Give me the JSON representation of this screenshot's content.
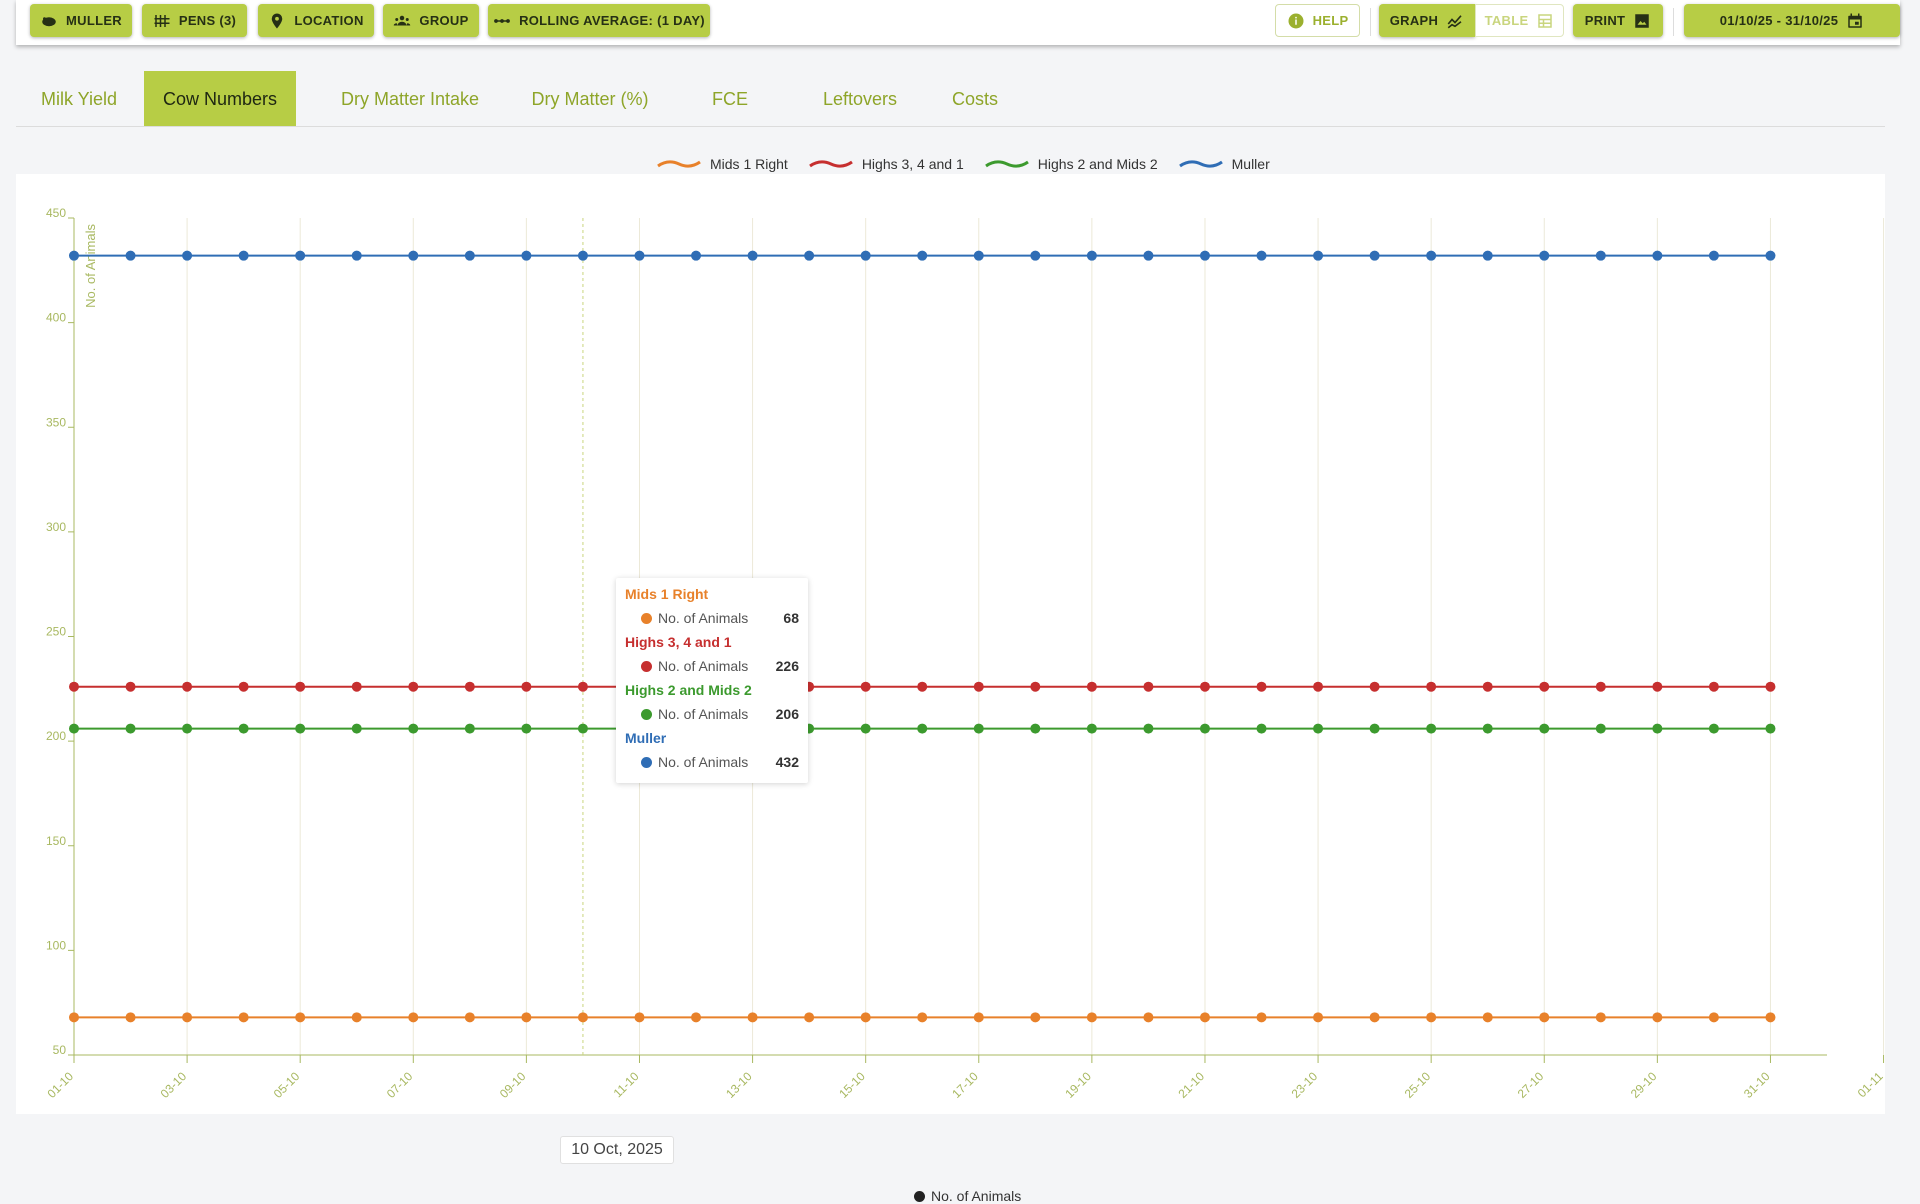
{
  "toolbar": {
    "muller": "MULLER",
    "pens": "PENS (3)",
    "location": "LOCATION",
    "group": "GROUP",
    "rolling": "ROLLING AVERAGE: (1 DAY)",
    "help": "HELP",
    "graph": "GRAPH",
    "table": "TABLE",
    "print": "PRINT",
    "date_range": "01/10/25 - 31/10/25"
  },
  "tabs": [
    "Milk Yield",
    "Cow Numbers",
    "Dry Matter Intake",
    "Dry Matter (%)",
    "FCE",
    "Leftovers",
    "Costs"
  ],
  "active_tab": "Cow Numbers",
  "colors": {
    "accent": "#b7cd45",
    "mids": "#e8812a",
    "highs341": "#c62f2f",
    "highs2": "#3c9a2e",
    "muller": "#2f6db5"
  },
  "tooltip": {
    "date": "10 Oct, 2025",
    "metric": "No. of Animals",
    "entries": [
      {
        "name": "Mids 1 Right",
        "value": "68"
      },
      {
        "name": "Highs 3, 4 and 1",
        "value": "226"
      },
      {
        "name": "Highs 2 and Mids 2",
        "value": "206"
      },
      {
        "name": "Muller",
        "value": "432"
      }
    ]
  },
  "bottom_legend": "No. of Animals",
  "chart_data": {
    "type": "line",
    "ylabel": "No. of Animals",
    "ylim": [
      50,
      450
    ],
    "yticks": [
      50,
      100,
      150,
      200,
      250,
      300,
      350,
      400,
      450
    ],
    "xlim": [
      "2025-10-01",
      "2025-11-01"
    ],
    "xticks": [
      "01-10",
      "03-10",
      "05-10",
      "07-10",
      "09-10",
      "11-10",
      "13-10",
      "15-10",
      "17-10",
      "19-10",
      "21-10",
      "23-10",
      "25-10",
      "27-10",
      "29-10",
      "31-10",
      "01-11"
    ],
    "x": [
      "2025-10-01",
      "2025-10-02",
      "2025-10-03",
      "2025-10-04",
      "2025-10-05",
      "2025-10-06",
      "2025-10-07",
      "2025-10-08",
      "2025-10-09",
      "2025-10-10",
      "2025-10-11",
      "2025-10-12",
      "2025-10-13",
      "2025-10-14",
      "2025-10-15",
      "2025-10-16",
      "2025-10-17",
      "2025-10-18",
      "2025-10-19",
      "2025-10-20",
      "2025-10-21",
      "2025-10-22",
      "2025-10-23",
      "2025-10-24",
      "2025-10-25",
      "2025-10-26",
      "2025-10-27",
      "2025-10-28",
      "2025-10-29",
      "2025-10-30",
      "2025-10-31"
    ],
    "series": [
      {
        "name": "Mids 1 Right",
        "color": "#e8812a",
        "values": [
          68,
          68,
          68,
          68,
          68,
          68,
          68,
          68,
          68,
          68,
          68,
          68,
          68,
          68,
          68,
          68,
          68,
          68,
          68,
          68,
          68,
          68,
          68,
          68,
          68,
          68,
          68,
          68,
          68,
          68,
          68
        ]
      },
      {
        "name": "Highs 3, 4 and 1",
        "color": "#c62f2f",
        "values": [
          226,
          226,
          226,
          226,
          226,
          226,
          226,
          226,
          226,
          226,
          226,
          226,
          226,
          226,
          226,
          226,
          226,
          226,
          226,
          226,
          226,
          226,
          226,
          226,
          226,
          226,
          226,
          226,
          226,
          226,
          226
        ]
      },
      {
        "name": "Highs 2 and Mids 2",
        "color": "#3c9a2e",
        "values": [
          206,
          206,
          206,
          206,
          206,
          206,
          206,
          206,
          206,
          206,
          206,
          206,
          206,
          206,
          206,
          206,
          206,
          206,
          206,
          206,
          206,
          206,
          206,
          206,
          206,
          206,
          206,
          206,
          206,
          206,
          206
        ]
      },
      {
        "name": "Muller",
        "color": "#2f6db5",
        "values": [
          432,
          432,
          432,
          432,
          432,
          432,
          432,
          432,
          432,
          432,
          432,
          432,
          432,
          432,
          432,
          432,
          432,
          432,
          432,
          432,
          432,
          432,
          432,
          432,
          432,
          432,
          432,
          432,
          432,
          432,
          432
        ]
      }
    ],
    "grid": true,
    "legend": "top-center",
    "hover_x": "2025-10-10"
  }
}
